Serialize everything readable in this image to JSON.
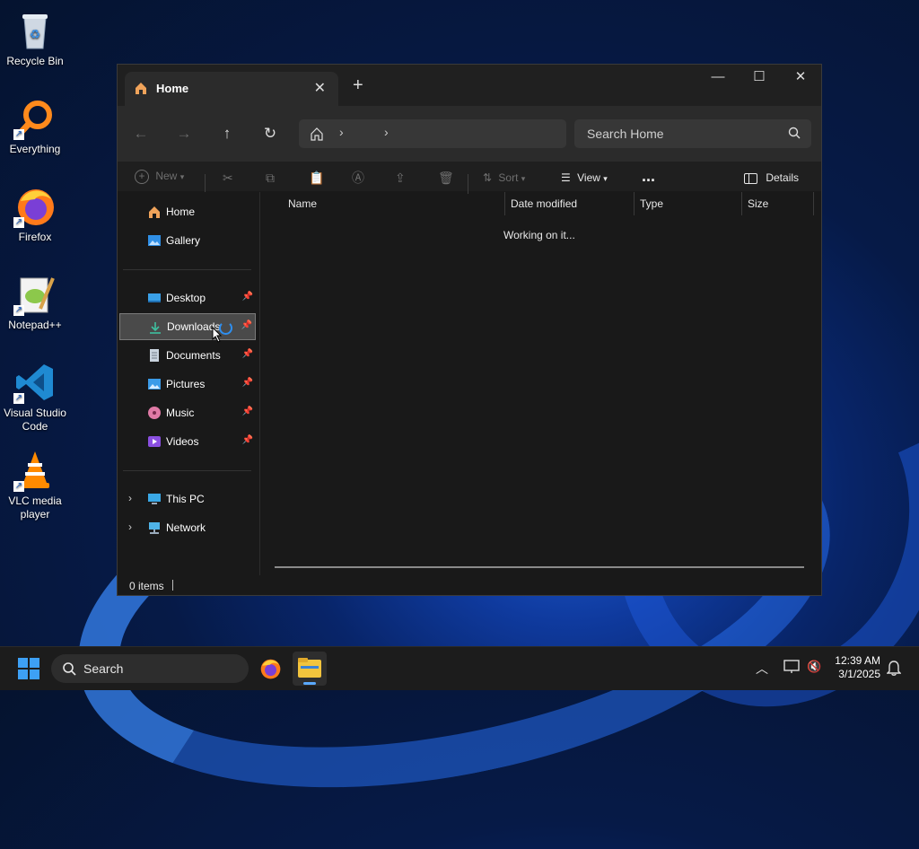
{
  "desktop": {
    "icons": [
      {
        "label": "Recycle Bin"
      },
      {
        "label": "Everything"
      },
      {
        "label": "Firefox"
      },
      {
        "label": "Notepad++"
      },
      {
        "label": "Visual Studio Code"
      },
      {
        "label": "VLC media player"
      }
    ]
  },
  "explorer": {
    "tab_title": "Home",
    "search_placeholder": "Search Home",
    "toolbar": {
      "new_label": "New",
      "sort_label": "Sort",
      "view_label": "View",
      "more_label": "...",
      "details_label": "Details"
    },
    "sidebar": {
      "top": [
        {
          "label": "Home"
        },
        {
          "label": "Gallery"
        }
      ],
      "pinned": [
        {
          "label": "Desktop"
        },
        {
          "label": "Downloads"
        },
        {
          "label": "Documents"
        },
        {
          "label": "Pictures"
        },
        {
          "label": "Music"
        },
        {
          "label": "Videos"
        }
      ],
      "bottom": [
        {
          "label": "This PC"
        },
        {
          "label": "Network"
        }
      ]
    },
    "columns": [
      "Name",
      "Date modified",
      "Type",
      "Size"
    ],
    "loading_text": "Working on it...",
    "status_text": "0 items"
  },
  "taskbar": {
    "search_label": "Search",
    "time": "12:39 AM",
    "date": "3/1/2025"
  }
}
